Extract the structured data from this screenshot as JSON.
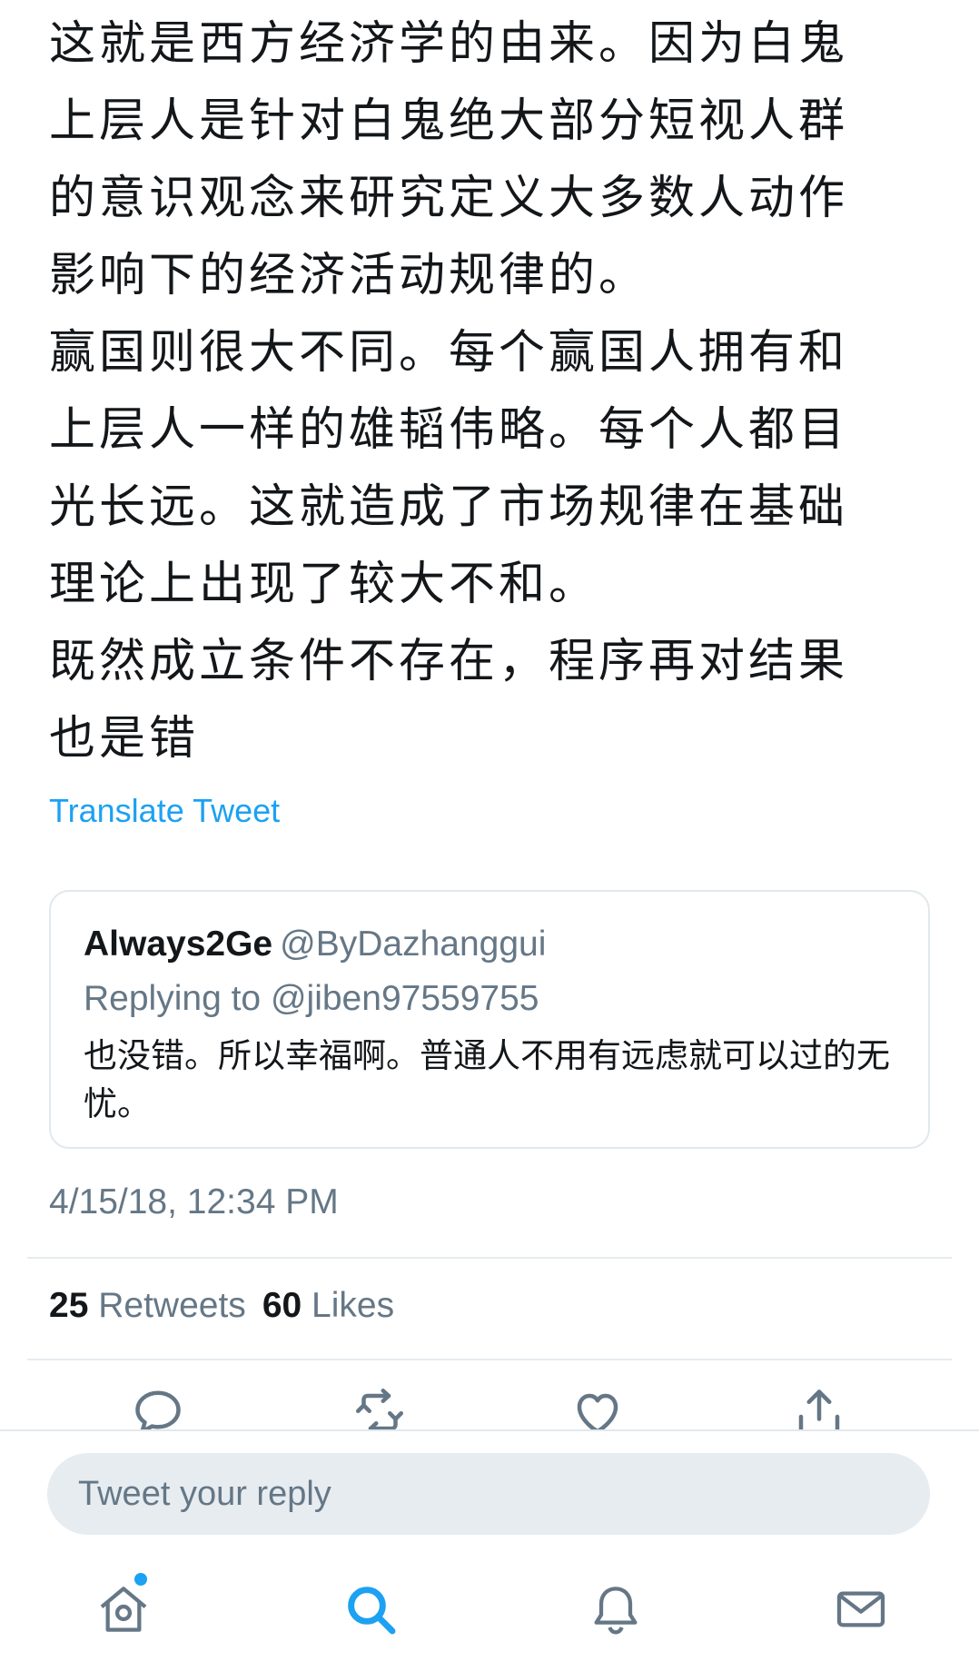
{
  "tweet": {
    "text": "这就是西方经济学的由来。因为白鬼\n上层人是针对白鬼绝大部分短视人群\n的意识观念来研究定义大多数人动作\n影响下的经济活动规律的。\n赢国则很大不同。每个赢国人拥有和\n上层人一样的雄韬伟略。每个人都目\n光长远。这就造成了市场规律在基础\n理论上出现了较大不和。\n既然成立条件不存在，程序再对结果\n也是错",
    "translate_label": "Translate Tweet",
    "timestamp": "4/15/18, 12:34 PM"
  },
  "quoted": {
    "name": "Always2Ge",
    "handle": "@ByDazhanggui",
    "replying_to": "Replying to @jiben97559755",
    "text": "也没错。所以幸福啊。普通人不用有远虑就可以过的无忧。"
  },
  "stats": {
    "retweets_count": "25",
    "retweets_label": "Retweets",
    "likes_count": "60",
    "likes_label": "Likes"
  },
  "actions": [
    "reply-icon",
    "retweet-icon",
    "like-icon",
    "share-icon"
  ],
  "compose": {
    "placeholder": "Tweet your reply"
  },
  "nav": [
    "home-icon",
    "search-icon",
    "notifications-icon",
    "messages-icon"
  ],
  "colors": {
    "accent": "#1da1f2",
    "muted": "#657786",
    "text": "#14171a",
    "border": "#e1e8ed"
  }
}
